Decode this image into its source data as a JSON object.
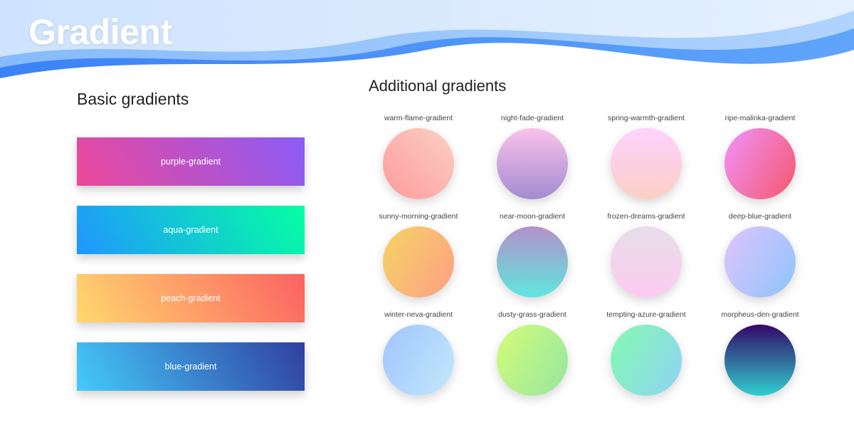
{
  "header": {
    "title": "Gradient",
    "wave_colors": {
      "back": [
        "#3b82f6",
        "#60a5fa"
      ],
      "mid": [
        "#93c5fd",
        "#bfdbfe"
      ],
      "front": [
        "#dbeafe",
        "#eff6ff"
      ]
    }
  },
  "basic": {
    "heading": "Basic gradients",
    "items": [
      {
        "label": "purple-gradient",
        "from": "#ec4899",
        "to": "#8b5cf6",
        "angle": 60
      },
      {
        "label": "aqua-gradient",
        "from": "#2096ff",
        "to": "#05ffa3",
        "angle": 60
      },
      {
        "label": "peach-gradient",
        "from": "#FFD86F",
        "to": "#FC6262",
        "angle": 60
      },
      {
        "label": "blue-gradient",
        "from": "#45cafc",
        "to": "#303f9f",
        "angle": 60
      }
    ]
  },
  "additional": {
    "heading": "Additional gradients",
    "items": [
      {
        "label": "warm-flame-gradient",
        "from": "#ff9a9e",
        "to": "#fad0c4",
        "angle": 45
      },
      {
        "label": "night-fade-gradient",
        "from": "#a18cd1",
        "to": "#fbc2eb",
        "angle": 0
      },
      {
        "label": "spring-warmth-gradient",
        "from": "#fad0c4",
        "to": "#ffd1ff",
        "angle": 0
      },
      {
        "label": "ripe-malinka-gradient",
        "from": "#f093fb",
        "to": "#f5576c",
        "angle": 120
      },
      {
        "label": "sunny-morning-gradient",
        "from": "#f6d365",
        "to": "#fda085",
        "angle": 120
      },
      {
        "label": "near-moon-gradient",
        "from": "#5ee7df",
        "to": "#b490ca",
        "angle": 0
      },
      {
        "label": "frozen-dreams-gradient",
        "from": "#fdcbf1",
        "to": "#e6dee9",
        "angle": 0
      },
      {
        "label": "deep-blue-gradient",
        "from": "#e0c3fc",
        "to": "#8ec5fc",
        "angle": 120
      },
      {
        "label": "winter-neva-gradient",
        "from": "#a1c4fd",
        "to": "#c2e9fb",
        "angle": 120
      },
      {
        "label": "dusty-grass-gradient",
        "from": "#d4fc79",
        "to": "#96e6a1",
        "angle": 120
      },
      {
        "label": "tempting-azure-gradient",
        "from": "#84fab0",
        "to": "#8fd3f4",
        "angle": 120
      },
      {
        "label": "morpheus-den-gradient",
        "from": "#30cfd0",
        "to": "#330867",
        "angle": 0
      }
    ]
  }
}
